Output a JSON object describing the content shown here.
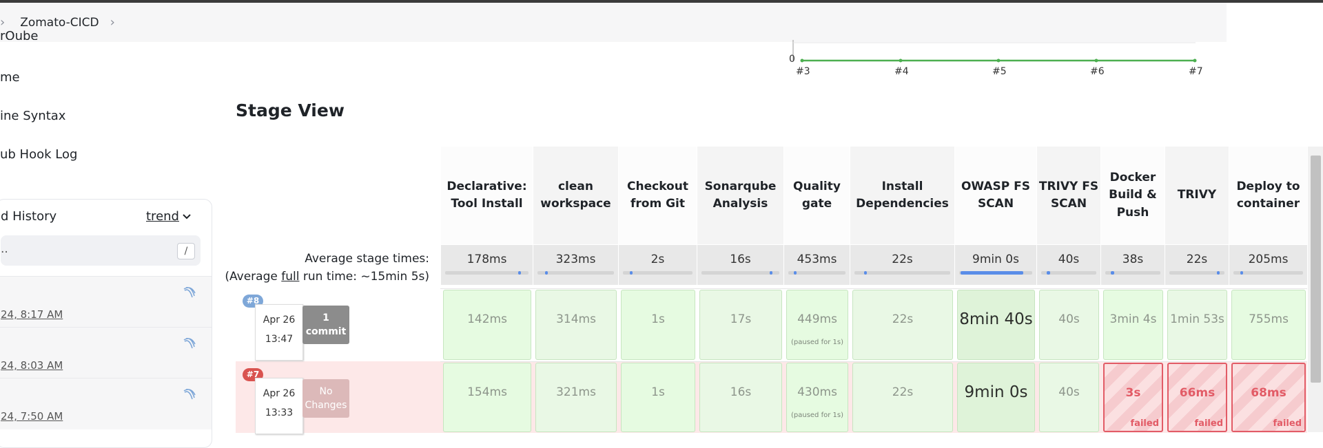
{
  "breadcrumb": {
    "project": "Zomato-CICD"
  },
  "sidebar": {
    "links": [
      "rQube",
      "me",
      "ine Syntax",
      "ub Hook Log"
    ]
  },
  "build_history": {
    "title": "d History",
    "trend_label": "trend",
    "filter_text": "..",
    "filter_shortcut": "/",
    "rows": [
      {
        "date": "24, 8:17 AM"
      },
      {
        "date": "24, 8:03 AM"
      },
      {
        "date": "24, 7:50 AM"
      }
    ]
  },
  "trend_chart": {
    "y_tick": "0",
    "x_ticks": [
      "#3",
      "#4",
      "#5",
      "#6",
      "#7"
    ]
  },
  "stage_view": {
    "title": "Stage View",
    "avg_label": "Average stage times:",
    "avg_full_prefix": "(Average ",
    "avg_full_link": "full",
    "avg_full_suffix": " run time: ~15min 5s)",
    "stages": [
      {
        "name": "Declarative: Tool Install",
        "avg": "178ms",
        "avg_fraction": 0.0
      },
      {
        "name": "clean workspace",
        "avg": "323ms",
        "avg_fraction": 0.01
      },
      {
        "name": "Checkout from Git",
        "avg": "2s",
        "avg_fraction": 0.02
      },
      {
        "name": "Sonarqube Analysis",
        "avg": "16s",
        "avg_fraction": 0.03
      },
      {
        "name": "Quality gate",
        "avg": "453ms",
        "avg_fraction": 0.01
      },
      {
        "name": "Install Dependencies",
        "avg": "22s",
        "avg_fraction": 0.03
      },
      {
        "name": "OWASP FS SCAN",
        "avg": "9min 0s",
        "avg_fraction": 0.85
      },
      {
        "name": "TRIVY FS SCAN",
        "avg": "40s",
        "avg_fraction": 0.06
      },
      {
        "name": "Docker Build & Push",
        "avg": "38s",
        "avg_fraction": 0.06
      },
      {
        "name": "TRIVY",
        "avg": "22s",
        "avg_fraction": 0.03
      },
      {
        "name": "Deploy to container",
        "avg": "205ms",
        "avg_fraction": 0.0
      }
    ],
    "builds": [
      {
        "number": "#8",
        "date": "Apr 26",
        "time": "13:47",
        "changes": "1\ncommit",
        "status": "success",
        "cells": [
          {
            "value": "142ms"
          },
          {
            "value": "314ms"
          },
          {
            "value": "1s"
          },
          {
            "value": "17s"
          },
          {
            "value": "449ms",
            "note": "(paused for 1s)"
          },
          {
            "value": "22s"
          },
          {
            "value": "8min 40s",
            "big": true
          },
          {
            "value": "40s"
          },
          {
            "value": "3min 4s"
          },
          {
            "value": "1min 53s"
          },
          {
            "value": "755ms"
          }
        ]
      },
      {
        "number": "#7",
        "date": "Apr 26",
        "time": "13:33",
        "changes": "No\nChanges",
        "status": "failed",
        "cells": [
          {
            "value": "154ms"
          },
          {
            "value": "321ms"
          },
          {
            "value": "1s"
          },
          {
            "value": "16s"
          },
          {
            "value": "430ms",
            "note": "(paused for 1s)"
          },
          {
            "value": "22s"
          },
          {
            "value": "9min 0s",
            "big": true
          },
          {
            "value": "40s"
          },
          {
            "value": "3s",
            "failed": true,
            "tag": "failed"
          },
          {
            "value": "66ms",
            "failed": true,
            "tag": "failed"
          },
          {
            "value": "68ms",
            "failed": true,
            "tag": "failed"
          }
        ]
      }
    ]
  },
  "colors": {
    "success_bg": "#e6fbe1",
    "failed_border": "#e25b66",
    "build8_badge": "#7ea7d8",
    "build7_badge": "#d9534f",
    "commit_badge": "#8c8c8c",
    "nochange_badge": "#dcb9b9",
    "row7_bg": "#fde8e8",
    "trend_line": "#4caf50"
  }
}
